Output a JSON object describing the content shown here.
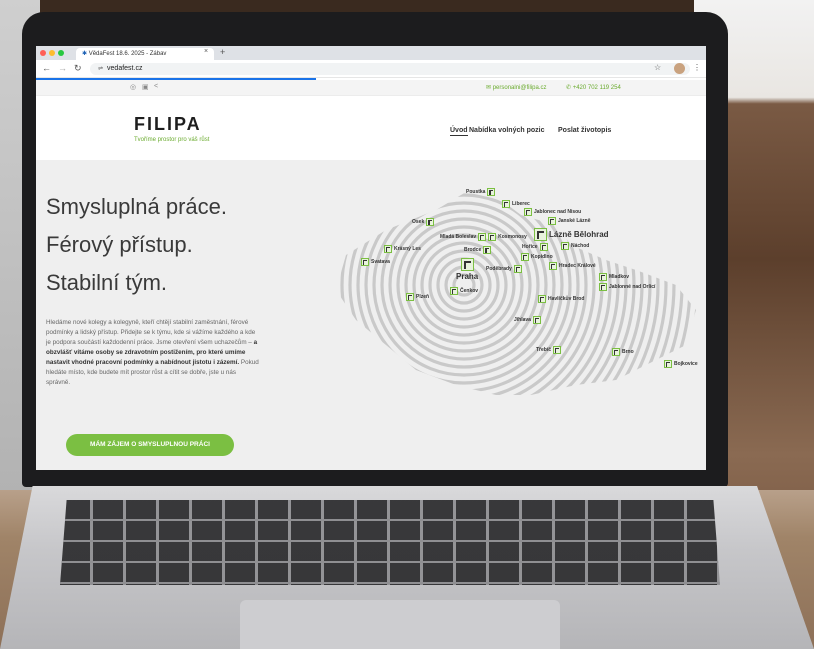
{
  "browser": {
    "tab_title": "VědaFest 18.6. 2025 - Zábav",
    "tab_close": "×",
    "new_tab": "+",
    "url": "vedafest.cz"
  },
  "site": {
    "topbar": {
      "email": "personalni@filipa.cz",
      "phone": "+420 702 119 254"
    },
    "logo": "FILIPA",
    "tagline": "Tvoříme prostor pro váš růst",
    "nav": [
      "Úvod",
      "Nabídka volných pozic",
      "Poslat životopis"
    ]
  },
  "hero": {
    "headline_1": "Smysluplná práce.",
    "headline_2": "Férový přístup.",
    "headline_3": "Stabilní tým.",
    "paragraph_part1": "Hledáme nové kolegy a kolegyně, kteří chtějí stabilní zaměstnání, férové podmínky a lidský přístup. Přidejte se k týmu, kde si vážíme každého a kde je podpora součástí každodenní práce. Jsme otevření všem uchazečům –",
    "paragraph_bold": "a obzvlášť vítáme osoby se zdravotním postižením, pro které umíme nastavit vhodné pracovní podmínky a nabídnout jistotu i zázemí.",
    "paragraph_part2": "Pokud hledáte místo, kde budete mít prostor růst a cítit se dobře, jste u nás správně.",
    "cta": "MÁM ZÁJEM O SMYSLUPLNOU PRÁCI"
  },
  "map_cities": {
    "poustka": "Poustka",
    "liberec": "Liberec",
    "jablonec": "Jablonec nad Nisou",
    "janske": "Janské Lázně",
    "lazne": "Lázně Bělohrad",
    "nachod": "Náchod",
    "osek": "Osek",
    "mlada": "Mladá Boleslav",
    "kosmonosy": "Kosmonosy",
    "horice": "Hořice",
    "kopidlno": "Kopidlno",
    "hradec": "Hradec Králové",
    "krasny": "Krásný Les",
    "brodce": "Brodce",
    "svatava": "Svatava",
    "praha": "Praha",
    "podebrady": "Poděbrady",
    "mladkov": "Mladkov",
    "jablonne": "Jablonné nad Orlicí",
    "cenkov": "Čenkov",
    "plzen": "Plzeň",
    "havlickuv": "Havlíčkův Brod",
    "jihlava": "Jihlava",
    "trebic": "Třebíč",
    "brno": "Brno",
    "bojkovice": "Bojkovice"
  }
}
